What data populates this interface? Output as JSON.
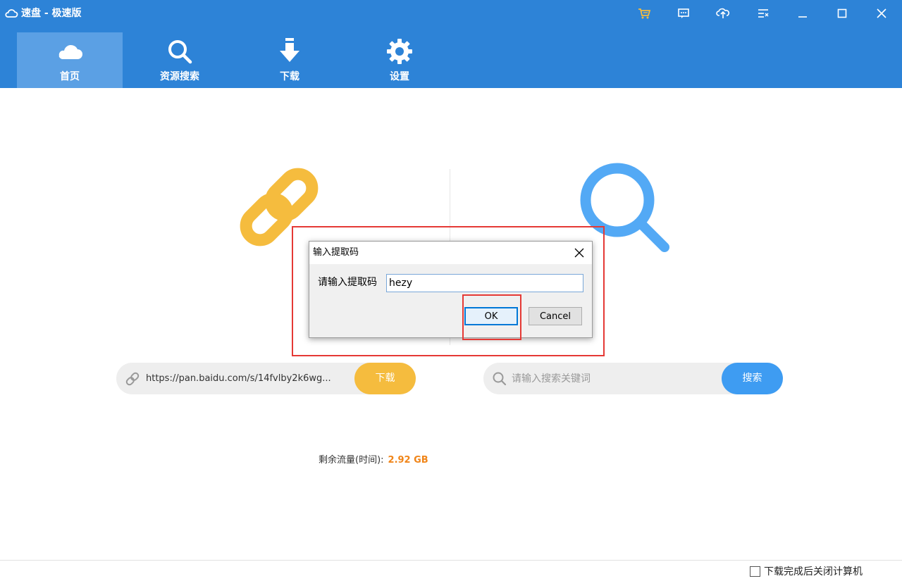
{
  "window": {
    "title": "速盘 - 极速版",
    "icons": [
      "cloud-icon",
      "cart-icon",
      "message-icon",
      "cloud-upload-icon",
      "menu-list-icon",
      "minimize-icon",
      "maximize-icon",
      "close-icon"
    ]
  },
  "nav": {
    "items": [
      {
        "label": "首页",
        "icon": "cloud-icon",
        "active": true
      },
      {
        "label": "资源搜索",
        "icon": "search-icon",
        "active": false
      },
      {
        "label": "下载",
        "icon": "download-arrow-icon",
        "active": false
      },
      {
        "label": "设置",
        "icon": "gear-icon",
        "active": false
      }
    ]
  },
  "main": {
    "url_value": "https://pan.baidu.com/s/14fvlby2k6wg...",
    "download_label": "下载",
    "search_placeholder": "请输入搜索关键词",
    "search_label": "搜索",
    "traffic_label": "剩余流量(时间):",
    "traffic_value": "2.92 GB"
  },
  "footer": {
    "shutdown_label": "下载完成后关闭计算机",
    "shutdown_checked": false
  },
  "dialog": {
    "title": "输入提取码",
    "prompt": "请输入提取码",
    "input_value": "hezy",
    "ok_label": "OK",
    "cancel_label": "Cancel"
  },
  "colors": {
    "header_bg": "#2d83d7",
    "nav_active_bg": "#5ba0e4",
    "download_button": "#f5bc3e",
    "search_button": "#3e9cf2",
    "traffic_value": "#f08519",
    "annotation": "#e53935"
  }
}
